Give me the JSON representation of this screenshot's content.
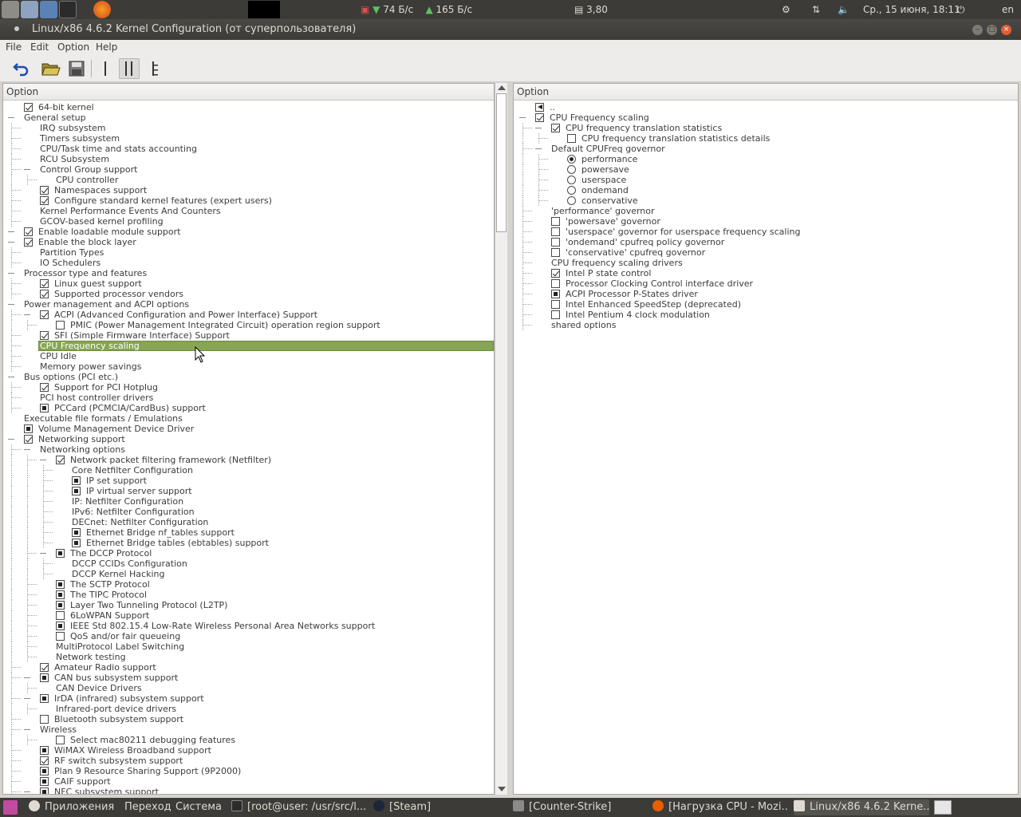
{
  "topbar": {
    "net_down": "74 Б/с",
    "net_up": "165 Б/с",
    "load": "3,80",
    "datetime": "Ср., 15 июня, 18:11",
    "lang": "en"
  },
  "window": {
    "title": "Linux/x86 4.6.2 Kernel Configuration (от суперпользователя)"
  },
  "menu": {
    "file": "File",
    "edit": "Edit",
    "option": "Option",
    "help": "Help"
  },
  "left": {
    "header": "Option",
    "rows": [
      {
        "text": "64-bit kernel",
        "box": "on",
        "depth": 0,
        "expander": false
      },
      {
        "text": "General setup",
        "box": "",
        "depth": 0,
        "expander": true
      },
      {
        "text": "IRQ subsystem",
        "box": "",
        "depth": 1
      },
      {
        "text": "Timers subsystem",
        "box": "",
        "depth": 1
      },
      {
        "text": "CPU/Task time and stats accounting",
        "box": "",
        "depth": 1
      },
      {
        "text": "RCU Subsystem",
        "box": "",
        "depth": 1
      },
      {
        "text": "Control Group support",
        "box": "",
        "depth": 1,
        "expander": true
      },
      {
        "text": "CPU controller",
        "box": "",
        "depth": 2
      },
      {
        "text": "Namespaces support",
        "box": "on",
        "depth": 1
      },
      {
        "text": "Configure standard kernel features (expert users)",
        "box": "on",
        "depth": 1
      },
      {
        "text": "Kernel Performance Events And Counters",
        "box": "",
        "depth": 1
      },
      {
        "text": "GCOV-based kernel profiling",
        "box": "",
        "depth": 1
      },
      {
        "text": "Enable loadable module support",
        "box": "on",
        "depth": 0,
        "expander": true
      },
      {
        "text": "Enable the block layer",
        "box": "on",
        "depth": 0,
        "expander": true
      },
      {
        "text": "Partition Types",
        "box": "",
        "depth": 1
      },
      {
        "text": "IO Schedulers",
        "box": "",
        "depth": 1
      },
      {
        "text": "Processor type and features",
        "box": "",
        "depth": 0,
        "expander": true
      },
      {
        "text": "Linux guest support",
        "box": "on",
        "depth": 1
      },
      {
        "text": "Supported processor vendors",
        "box": "on",
        "depth": 1
      },
      {
        "text": "Power management and ACPI options",
        "box": "",
        "depth": 0,
        "expander": true
      },
      {
        "text": "ACPI (Advanced Configuration and Power Interface) Support",
        "box": "on",
        "depth": 1,
        "expander": true
      },
      {
        "text": "PMIC (Power Management Integrated Circuit) operation region support",
        "box": "off",
        "depth": 2
      },
      {
        "text": "SFI (Simple Firmware Interface) Support",
        "box": "on",
        "depth": 1
      },
      {
        "text": "CPU Frequency scaling",
        "box": "",
        "depth": 1,
        "selected": true
      },
      {
        "text": "CPU Idle",
        "box": "",
        "depth": 1
      },
      {
        "text": "Memory power savings",
        "box": "",
        "depth": 1
      },
      {
        "text": "Bus options (PCI etc.)",
        "box": "",
        "depth": 0,
        "expander": true
      },
      {
        "text": "Support for PCI Hotplug",
        "box": "on",
        "depth": 1
      },
      {
        "text": "PCI host controller drivers",
        "box": "",
        "depth": 1
      },
      {
        "text": "PCCard (PCMCIA/CardBus) support",
        "box": "mod",
        "depth": 1
      },
      {
        "text": "Executable file formats / Emulations",
        "box": "",
        "depth": 0
      },
      {
        "text": "Volume Management Device Driver",
        "box": "mod",
        "depth": 0
      },
      {
        "text": "Networking support",
        "box": "on",
        "depth": 0,
        "expander": true
      },
      {
        "text": "Networking options",
        "box": "",
        "depth": 1,
        "expander": true
      },
      {
        "text": "Network packet filtering framework (Netfilter)",
        "box": "on",
        "depth": 2,
        "expander": true
      },
      {
        "text": "Core Netfilter Configuration",
        "box": "",
        "depth": 3
      },
      {
        "text": "IP set support",
        "box": "mod",
        "depth": 3
      },
      {
        "text": "IP virtual server support",
        "box": "mod",
        "depth": 3
      },
      {
        "text": "IP: Netfilter Configuration",
        "box": "",
        "depth": 3
      },
      {
        "text": "IPv6: Netfilter Configuration",
        "box": "",
        "depth": 3
      },
      {
        "text": "DECnet: Netfilter Configuration",
        "box": "",
        "depth": 3
      },
      {
        "text": "Ethernet Bridge nf_tables support",
        "box": "mod",
        "depth": 3
      },
      {
        "text": "Ethernet Bridge tables (ebtables) support",
        "box": "mod",
        "depth": 3
      },
      {
        "text": "The DCCP Protocol",
        "box": "mod",
        "depth": 2,
        "expander": true
      },
      {
        "text": "DCCP CCIDs Configuration",
        "box": "",
        "depth": 3
      },
      {
        "text": "DCCP Kernel Hacking",
        "box": "",
        "depth": 3
      },
      {
        "text": "The SCTP Protocol",
        "box": "mod",
        "depth": 2
      },
      {
        "text": "The TIPC Protocol",
        "box": "mod",
        "depth": 2
      },
      {
        "text": "Layer Two Tunneling Protocol (L2TP)",
        "box": "mod",
        "depth": 2
      },
      {
        "text": "6LoWPAN Support",
        "box": "off",
        "depth": 2
      },
      {
        "text": "IEEE Std 802.15.4 Low-Rate Wireless Personal Area Networks support",
        "box": "mod",
        "depth": 2
      },
      {
        "text": "QoS and/or fair queueing",
        "box": "off",
        "depth": 2
      },
      {
        "text": "MultiProtocol Label Switching",
        "box": "",
        "depth": 2
      },
      {
        "text": "Network testing",
        "box": "",
        "depth": 2
      },
      {
        "text": "Amateur Radio support",
        "box": "on",
        "depth": 1
      },
      {
        "text": "CAN bus subsystem support",
        "box": "mod",
        "depth": 1,
        "expander": true
      },
      {
        "text": "CAN Device Drivers",
        "box": "",
        "depth": 2
      },
      {
        "text": "IrDA (infrared) subsystem support",
        "box": "mod",
        "depth": 1,
        "expander": true
      },
      {
        "text": "Infrared-port device drivers",
        "box": "",
        "depth": 2
      },
      {
        "text": "Bluetooth subsystem support",
        "box": "off",
        "depth": 1
      },
      {
        "text": "Wireless",
        "box": "",
        "depth": 1,
        "expander": true
      },
      {
        "text": "Select mac80211 debugging features",
        "box": "off",
        "depth": 2
      },
      {
        "text": "WiMAX Wireless Broadband support",
        "box": "mod",
        "depth": 1
      },
      {
        "text": "RF switch subsystem support",
        "box": "on",
        "depth": 1
      },
      {
        "text": "Plan 9 Resource Sharing Support (9P2000)",
        "box": "mod",
        "depth": 1
      },
      {
        "text": "CAIF support",
        "box": "mod",
        "depth": 1
      },
      {
        "text": "NFC subsystem support",
        "box": "mod",
        "depth": 1,
        "expander": true
      }
    ]
  },
  "right": {
    "header": "Option",
    "rows": [
      {
        "text": "..",
        "box": "tri",
        "depth": 0
      },
      {
        "text": "CPU Frequency scaling",
        "box": "on",
        "depth": 0,
        "expander": true
      },
      {
        "text": "CPU frequency translation statistics",
        "box": "on",
        "depth": 1,
        "expander": true
      },
      {
        "text": "CPU frequency translation statistics details",
        "box": "off",
        "depth": 2
      },
      {
        "text": "Default CPUFreq governor",
        "box": "",
        "depth": 1,
        "expander": true
      },
      {
        "text": "performance",
        "box": "radio-on",
        "depth": 2
      },
      {
        "text": "powersave",
        "box": "radio",
        "depth": 2
      },
      {
        "text": "userspace",
        "box": "radio",
        "depth": 2
      },
      {
        "text": "ondemand",
        "box": "radio",
        "depth": 2
      },
      {
        "text": "conservative",
        "box": "radio",
        "depth": 2
      },
      {
        "text": "'performance' governor",
        "box": "",
        "depth": 1
      },
      {
        "text": "'powersave' governor",
        "box": "off",
        "depth": 1
      },
      {
        "text": "'userspace' governor for userspace frequency scaling",
        "box": "off",
        "depth": 1
      },
      {
        "text": "'ondemand' cpufreq policy governor",
        "box": "off",
        "depth": 1
      },
      {
        "text": "'conservative' cpufreq governor",
        "box": "off",
        "depth": 1
      },
      {
        "text": "CPU frequency scaling drivers",
        "box": "",
        "depth": 1
      },
      {
        "text": "Intel P state control",
        "box": "on",
        "depth": 1
      },
      {
        "text": "Processor Clocking Control interface driver",
        "box": "off",
        "depth": 1
      },
      {
        "text": "ACPI Processor P-States driver",
        "box": "mod",
        "depth": 1
      },
      {
        "text": "Intel Enhanced SpeedStep (deprecated)",
        "box": "off",
        "depth": 1
      },
      {
        "text": "Intel Pentium 4 clock modulation",
        "box": "off",
        "depth": 1
      },
      {
        "text": "shared options",
        "box": "",
        "depth": 1
      }
    ]
  },
  "taskbar": {
    "apps": "Приложения",
    "places": "Переход",
    "system": "Система",
    "tasks": [
      {
        "label": "[root@user: /usr/src/l..."
      },
      {
        "label": "[Steam]"
      },
      {
        "label": "[Counter-Strike]"
      },
      {
        "label": "[Нагрузка CPU - Mozi..."
      },
      {
        "label": "Linux/x86 4.6.2 Kerne..."
      }
    ]
  },
  "colors": {
    "selection": "#87a556",
    "panel": "#3c3b37"
  }
}
